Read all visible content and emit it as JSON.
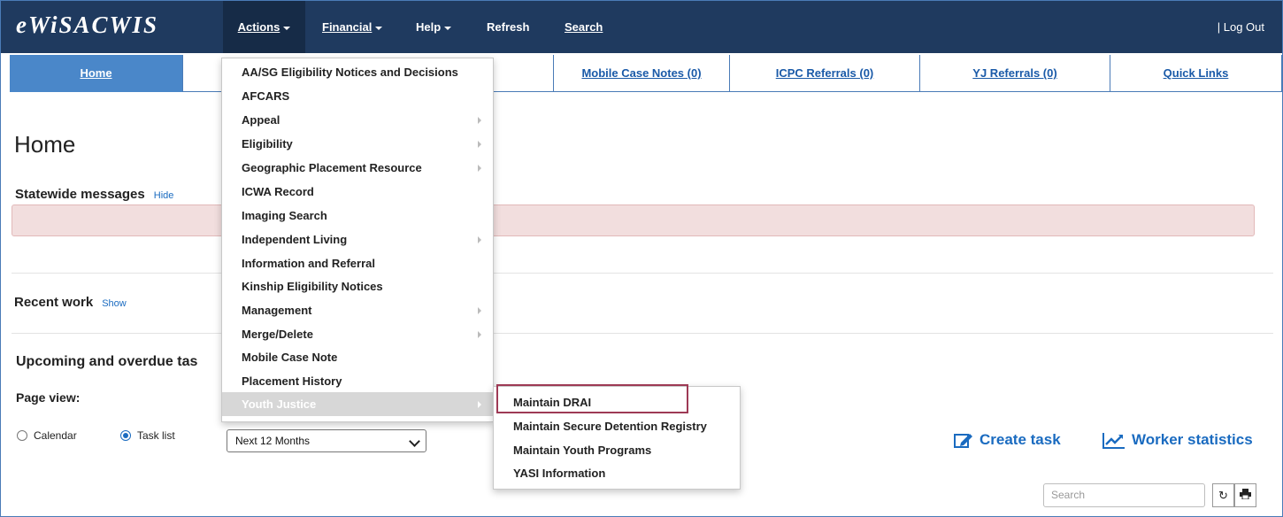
{
  "app": {
    "brand": "eWiSACWIS"
  },
  "navbar": {
    "items": [
      {
        "label": "Actions",
        "underline": "A",
        "rest": "ctions",
        "has_caret": true
      },
      {
        "label": "Financial",
        "underline": "F",
        "rest": "inancial",
        "has_caret": true
      },
      {
        "label": "Help",
        "pre": "Hel",
        "underline": "p",
        "has_caret": true
      },
      {
        "label": "Refresh",
        "pre": "R",
        "underline": "e",
        "rest": "fresh"
      },
      {
        "label": "Search",
        "underline": "S",
        "rest": "earch"
      }
    ],
    "logout": "| Log Out"
  },
  "tabs": [
    {
      "label": "Home",
      "underline": "H",
      "rest": "ome"
    },
    {
      "label": "Mobile Case Notes (0)",
      "underline": "M",
      "rest": "obile Case Notes (0)"
    },
    {
      "label": "ICPC Referrals (0)",
      "underline": "I",
      "rest": "CPC Referrals (0)"
    },
    {
      "label": "YJ Referrals (0)",
      "underline": "Y",
      "rest": "J Referrals (0)"
    },
    {
      "label": "Quick Links",
      "underline": "Q",
      "rest": "uick Links"
    }
  ],
  "page": {
    "title": "Home",
    "statewide_messages": {
      "title": "Statewide messages",
      "toggle": "Hide"
    },
    "recent_work": {
      "title": "Recent work",
      "toggle": "Show"
    },
    "upcoming_title": "Upcoming and overdue tas",
    "page_view_label": "Page view:",
    "view_options": [
      {
        "label": "Calendar",
        "checked": false
      },
      {
        "label": "Task list",
        "checked": true
      }
    ],
    "period_select": "Next 12 Months",
    "create_task": "Create task",
    "worker_statistics": "Worker statistics",
    "search_placeholder": "Search"
  },
  "actions_menu": {
    "items": [
      {
        "label": "AA/SG Eligibility Notices and Decisions",
        "submenu": false
      },
      {
        "label": "AFCARS",
        "submenu": false
      },
      {
        "label": "Appeal",
        "submenu": true
      },
      {
        "label": "Eligibility",
        "submenu": true
      },
      {
        "label": "Geographic Placement Resource",
        "submenu": true
      },
      {
        "label": "ICWA Record",
        "submenu": false
      },
      {
        "label": "Imaging Search",
        "submenu": false
      },
      {
        "label": "Independent Living",
        "submenu": true
      },
      {
        "label": "Information and Referral",
        "submenu": false
      },
      {
        "label": "Kinship Eligibility Notices",
        "submenu": false
      },
      {
        "label": "Management",
        "submenu": true
      },
      {
        "label": "Merge/Delete",
        "submenu": true
      },
      {
        "label": "Mobile Case Note",
        "submenu": false
      },
      {
        "label": "Placement History",
        "submenu": false
      },
      {
        "label": "Youth Justice",
        "submenu": true,
        "highlighted": true
      }
    ]
  },
  "youth_justice_submenu": {
    "items": [
      {
        "label": "Maintain DRAI",
        "outlined": true
      },
      {
        "label": "Maintain Secure Detention Registry"
      },
      {
        "label": "Maintain Youth Programs"
      },
      {
        "label": "YASI Information"
      }
    ]
  },
  "colors": {
    "navbar": "#1f3a5f",
    "active_tab": "#4a87c9",
    "link": "#1a6bc0",
    "alert_bg": "#f2dede",
    "highlight_outline": "#9e3a55"
  }
}
